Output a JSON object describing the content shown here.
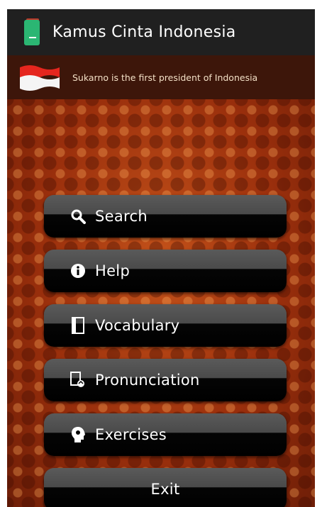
{
  "app": {
    "title": "Kamus Cinta Indonesia"
  },
  "banner": {
    "text": "Sukarno is the first president of Indonesia"
  },
  "menu": {
    "items": [
      {
        "label": "Search",
        "icon": "search-icon"
      },
      {
        "label": "Help",
        "icon": "info-icon"
      },
      {
        "label": "Vocabulary",
        "icon": "book-icon"
      },
      {
        "label": "Pronunciation",
        "icon": "pronunciation-icon"
      },
      {
        "label": "Exercises",
        "icon": "exercise-head-icon"
      },
      {
        "label": "Exit"
      }
    ]
  },
  "colors": {
    "appbar": "#202020",
    "banner": "#3d160a",
    "background": "#a8380f",
    "button": "#000000",
    "text": "#ffffff"
  }
}
